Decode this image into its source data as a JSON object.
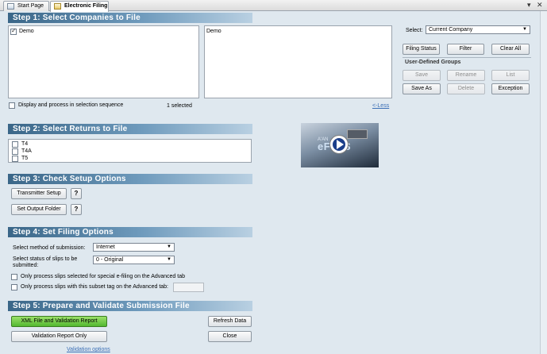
{
  "tabs": [
    {
      "label": "Start Page",
      "icon": "home-page-icon"
    },
    {
      "label": "Electronic Filing",
      "icon": "document-icon"
    }
  ],
  "window_controls": {
    "dropdown": "▾",
    "close": "✕"
  },
  "step1": {
    "title": "Step 1: Select Companies to File",
    "left_list": [
      {
        "label": "Demo",
        "checked": true
      }
    ],
    "right_list": [
      "Demo"
    ],
    "sequence_checkbox_label": "Display and process in selection sequence",
    "selected_count": "1 selected",
    "less_link": "<-Less",
    "select_label": "Select:",
    "select_value": "Current Company",
    "buttons": {
      "filing_status": "Filing Status",
      "filter": "Filter",
      "clear_all": "Clear All"
    },
    "groups_title": "User-Defined Groups",
    "group_buttons": {
      "save": "Save",
      "rename": "Rename",
      "list": "List",
      "save_as": "Save As",
      "delete": "Delete",
      "exception": "Exception"
    }
  },
  "step2": {
    "title": "Step 2: Select Returns to File",
    "returns": [
      {
        "label": "T4"
      },
      {
        "label": "T4A"
      },
      {
        "label": "T5"
      }
    ]
  },
  "video": {
    "text": "eF●●S",
    "prefix": "A'AN"
  },
  "step3": {
    "title": "Step 3: Check Setup Options",
    "transmitter_setup": "Transmitter Setup",
    "set_output_folder": "Set Output Folder",
    "help": "?"
  },
  "step4": {
    "title": "Step 4: Set Filing Options",
    "method_label": "Select method of submission:",
    "method_value": "Internet",
    "status_label_line1": "Select status of slips to be",
    "status_label_line2": "submitted:",
    "status_value": "0 - Original",
    "special_efiling_label": "Only process slips selected for special e-filing on the Advanced tab",
    "subset_tag_label": "Only process slips with this subset tag on the Advanced tab:"
  },
  "step5": {
    "title": "Step 5: Prepare and Validate Submission File",
    "xml_button": "XML File and Validation Report",
    "validation_only_button": "Validation Report Only",
    "validation_options_link": "Validation options",
    "refresh_button": "Refresh Data",
    "close_button": "Close"
  }
}
